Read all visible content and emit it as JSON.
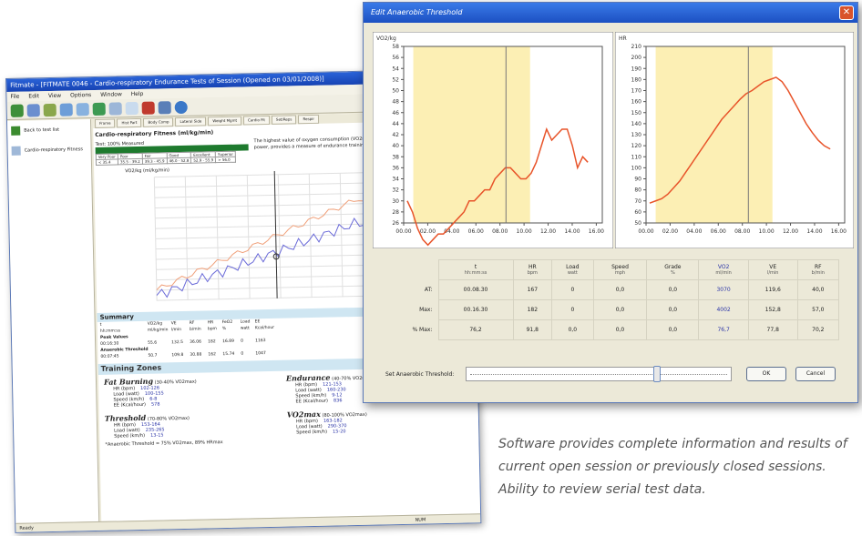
{
  "back_window": {
    "title": "Fitmate - [FITMATE 0046 - Cardio-respiratory Endurance Tests of Session (Opened on 03/01/2008)]",
    "menu": [
      "File",
      "Edit",
      "View",
      "Options",
      "Window",
      "Help"
    ],
    "nav_items": [
      "Back to test list",
      "Cardio-respiratory Fitness"
    ],
    "tabs": [
      "Frame",
      "Hist Part",
      "Body Comp",
      "Lateral Side",
      "Weight Mgmt",
      "Cardio Fit",
      "Set/Reps",
      "Respir"
    ],
    "section_title": "Cardio-respiratory Fitness (ml/kg/min)",
    "test_label": "Test: 100% Measured",
    "peak_table": {
      "headers": [
        "Very Poor",
        "Poor",
        "Fair",
        "Good",
        "Excellent",
        "Superior"
      ],
      "values": [
        "< 35.4",
        "35.5 - 39.2",
        "39.3 - 45.9",
        "46.0 - 52.8",
        "52.9 - 55.9",
        "> 56.0"
      ]
    },
    "info_text": "The highest value of oxygen consumption (VO2max), also called maximal aerobic power, provides a measure of endurance training. High VO2 max values...",
    "chart_title": "VO2/kg (ml/kg/min)",
    "summary_title": "Summary",
    "summary_headers": [
      "t",
      "VO2/kg",
      "VE",
      "RF",
      "HR",
      "FeO2",
      "Load",
      "EE"
    ],
    "summary_units": [
      "hh:mm:ss",
      "ml/kg/min",
      "l/min",
      "b/min",
      "bpm",
      "%",
      "watt",
      "Kcal/hour"
    ],
    "summary_rows": [
      {
        "label": "Peak Values",
        "t": "00:16:30",
        "vals": [
          "55.6",
          "132.5",
          "36.06",
          "182",
          "16.89",
          "0",
          "1163"
        ]
      },
      {
        "label": "Anaerobic Threshold",
        "t": "00:07:45",
        "vals": [
          "50.7",
          "109.8",
          "30.88",
          "162",
          "15.74",
          "0",
          "1047"
        ]
      }
    ],
    "training_title": "Training Zones",
    "zones": [
      {
        "name": "Fat Burning",
        "range": "(30-40% VO2max)",
        "rows": [
          [
            "HR (bpm)",
            "102-126"
          ],
          [
            "Load (watt)",
            "100-155"
          ],
          [
            "Speed (km/h)",
            "6-8"
          ],
          [
            "EE (Kcal/hour)",
            "578"
          ]
        ]
      },
      {
        "name": "Endurance",
        "range": "(40-70% VO2max)",
        "rows": [
          [
            "HR (bpm)",
            "121-153"
          ],
          [
            "Load (watt)",
            "160-230"
          ],
          [
            "Speed (km/h)",
            "9-12"
          ],
          [
            "EE (Kcal/hour)",
            "836"
          ]
        ]
      },
      {
        "name": "Threshold",
        "range": "(70-80% VO2max)",
        "rows": [
          [
            "HR (bpm)",
            "153-164"
          ],
          [
            "Load (watt)",
            "235-265"
          ],
          [
            "Speed (km/h)",
            "13-15"
          ]
        ]
      },
      {
        "name": "VO2max",
        "range": "(80-100% VO2max)",
        "rows": [
          [
            "HR (bpm)",
            "163-182"
          ],
          [
            "Load (watt)",
            "290-370"
          ],
          [
            "Speed (km/h)",
            "15-20"
          ]
        ]
      }
    ],
    "footnote": "*Anaerobic Threshold = 75% VO2max, 89% HRmax",
    "status_left": "Ready",
    "status_right": "NUM"
  },
  "dialog": {
    "title": "Edit Anaerobic Threshold",
    "close_glyph": "✕",
    "left_chart_label": "VO2/kg",
    "right_chart_label": "HR",
    "table": {
      "columns": [
        {
          "name": "t",
          "unit": "hh:mm:ss"
        },
        {
          "name": "HR",
          "unit": "bpm"
        },
        {
          "name": "Load",
          "unit": "watt"
        },
        {
          "name": "Speed",
          "unit": "mph"
        },
        {
          "name": "Grade",
          "unit": "%"
        },
        {
          "name": "VO2",
          "unit": "ml/min"
        },
        {
          "name": "VE",
          "unit": "l/min"
        },
        {
          "name": "RF",
          "unit": "b/min"
        }
      ],
      "rows": [
        {
          "label": "AT:",
          "values": [
            "00.08.30",
            "167",
            "0",
            "0,0",
            "0,0",
            "3070",
            "119,6",
            "40,0"
          ]
        },
        {
          "label": "Max:",
          "values": [
            "00.16.30",
            "182",
            "0",
            "0,0",
            "0,0",
            "4002",
            "152,8",
            "57,0"
          ]
        },
        {
          "label": "% Max:",
          "values": [
            "76,2",
            "91,8",
            "0,0",
            "0,0",
            "0,0",
            "76,7",
            "77,8",
            "70,2"
          ]
        }
      ]
    },
    "threshold_label": "Set Anaerobic Threshold:",
    "threshold_fraction": 0.72,
    "ok_label": "OK",
    "cancel_label": "Cancel"
  },
  "caption": "Software provides complete information and results of current open session or previously closed sessions. Ability to review serial test data.",
  "chart_data": [
    {
      "type": "line",
      "title": "",
      "ylabel": "VO2/kg",
      "x": [
        "00.00",
        "02.00",
        "04.00",
        "06.00",
        "08.00",
        "10.00",
        "12.00",
        "14.00",
        "16.00"
      ],
      "y_ticks": [
        "26",
        "28",
        "30",
        "32",
        "34",
        "36",
        "38",
        "40",
        "42",
        "44",
        "46",
        "48",
        "50",
        "52",
        "54",
        "56",
        "58"
      ],
      "ylim": [
        26,
        58
      ],
      "threshold_time": "08.30",
      "shaded_until": "10.30",
      "series": [
        {
          "values": [
            30,
            28,
            25,
            23,
            22,
            23,
            24,
            24,
            25,
            26,
            27,
            28,
            30,
            30,
            31,
            32,
            32,
            34,
            35,
            36,
            36,
            35,
            34,
            34,
            35,
            37,
            40,
            43,
            41,
            42,
            43,
            43,
            40,
            36,
            38,
            37
          ]
        }
      ]
    },
    {
      "type": "line",
      "title": "",
      "ylabel": "HR",
      "x": [
        "00.00",
        "02.00",
        "04.00",
        "06.00",
        "08.00",
        "10.00",
        "12.00",
        "14.00",
        "16.00"
      ],
      "y_ticks": [
        "50",
        "60",
        "70",
        "80",
        "90",
        "100",
        "110",
        "120",
        "130",
        "140",
        "150",
        "160",
        "170",
        "180",
        "190",
        "200",
        "210"
      ],
      "ylim": [
        50,
        210
      ],
      "threshold_time": "08.30",
      "shaded_until": "10.30",
      "series": [
        {
          "values": [
            68,
            70,
            72,
            76,
            82,
            88,
            96,
            104,
            112,
            120,
            128,
            136,
            144,
            150,
            156,
            162,
            167,
            170,
            174,
            178,
            180,
            182,
            178,
            170,
            160,
            150,
            140,
            132,
            125,
            120,
            117
          ]
        }
      ]
    }
  ]
}
